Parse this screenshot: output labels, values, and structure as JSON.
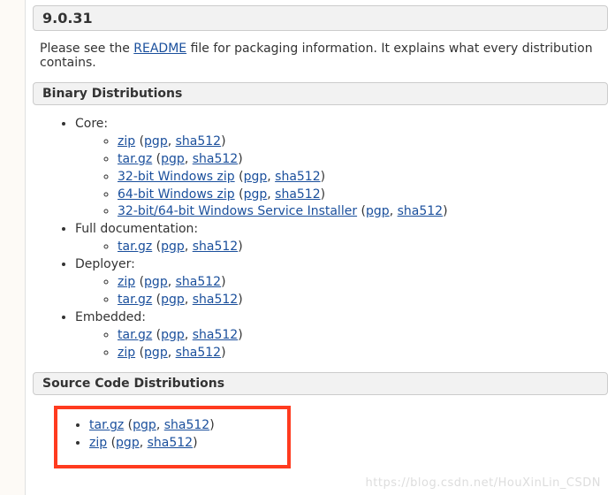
{
  "version": "9.0.31",
  "intro": {
    "prefix": "Please see the ",
    "readme_link": "README",
    "suffix": " file for packaging information. It explains what every distribution contains."
  },
  "sections": {
    "binary": "Binary Distributions",
    "source": "Source Code Distributions"
  },
  "labels": {
    "core": "Core:",
    "full_doc": "Full documentation:",
    "deployer": "Deployer:",
    "embedded": "Embedded:"
  },
  "link_text": {
    "zip": "zip",
    "targz": "tar.gz",
    "win32zip": "32-bit Windows zip",
    "win64zip": "64-bit Windows zip",
    "win_installer": "32-bit/64-bit Windows Service Installer",
    "pgp": "pgp",
    "sha512": "sha512"
  },
  "watermark": "https://blog.csdn.net/HouXinLin_CSDN"
}
